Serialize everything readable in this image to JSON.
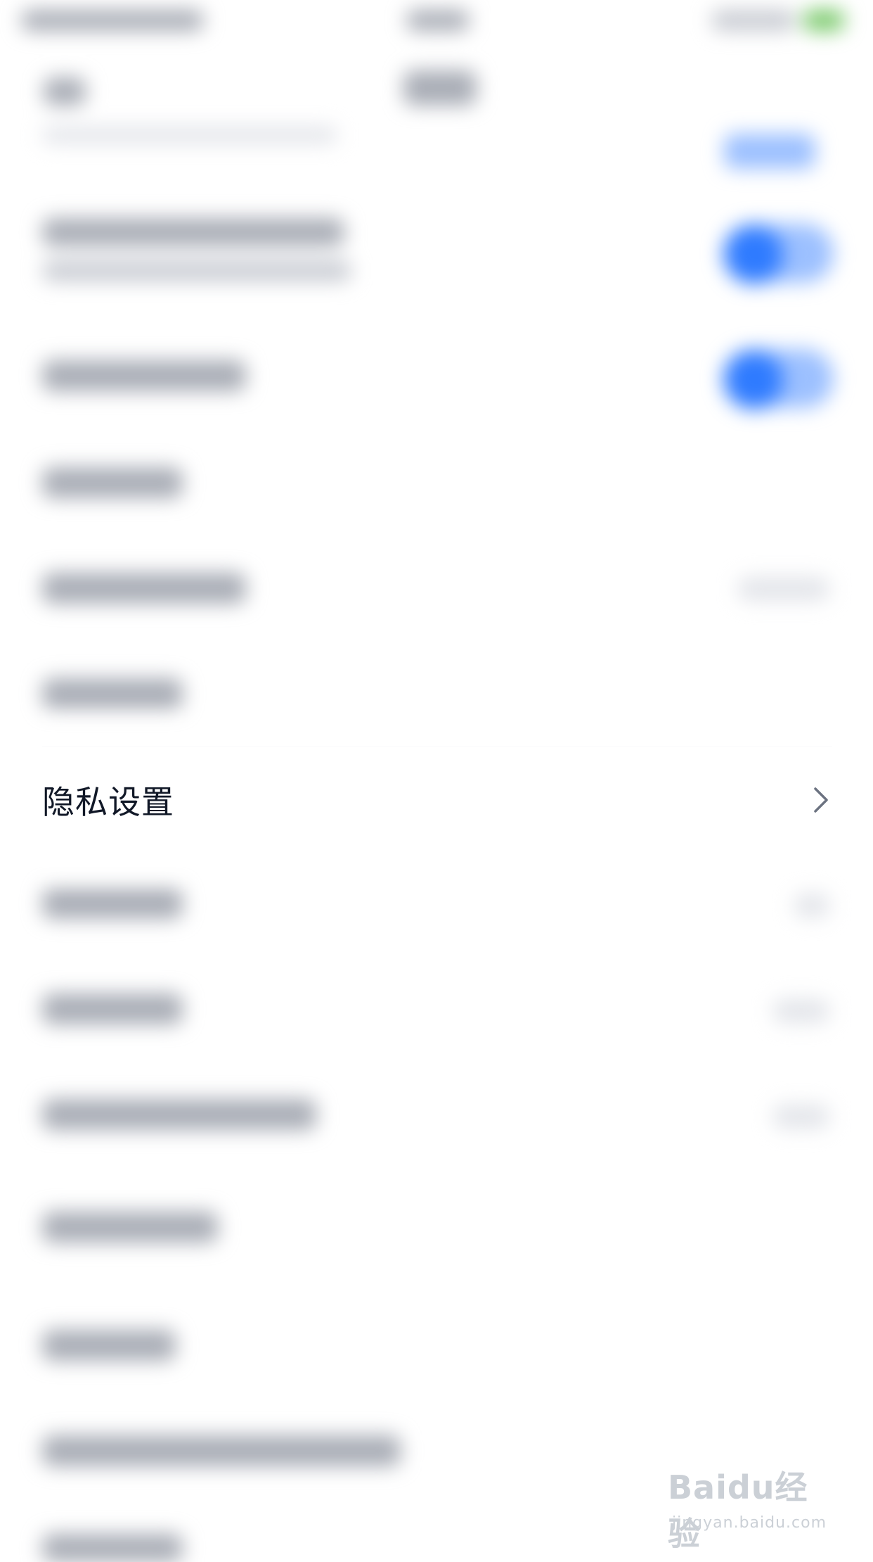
{
  "settings": {
    "privacy_row": {
      "label": "隐私设置",
      "icon": "chevron-right-icon"
    }
  },
  "watermark": {
    "brand": "Baidu经验",
    "url": "jingyan.baidu.com"
  },
  "colors": {
    "accent": "#2f7bff",
    "text": "#111827",
    "chevron": "#6b7280",
    "watermark": "#c3c8d0"
  }
}
